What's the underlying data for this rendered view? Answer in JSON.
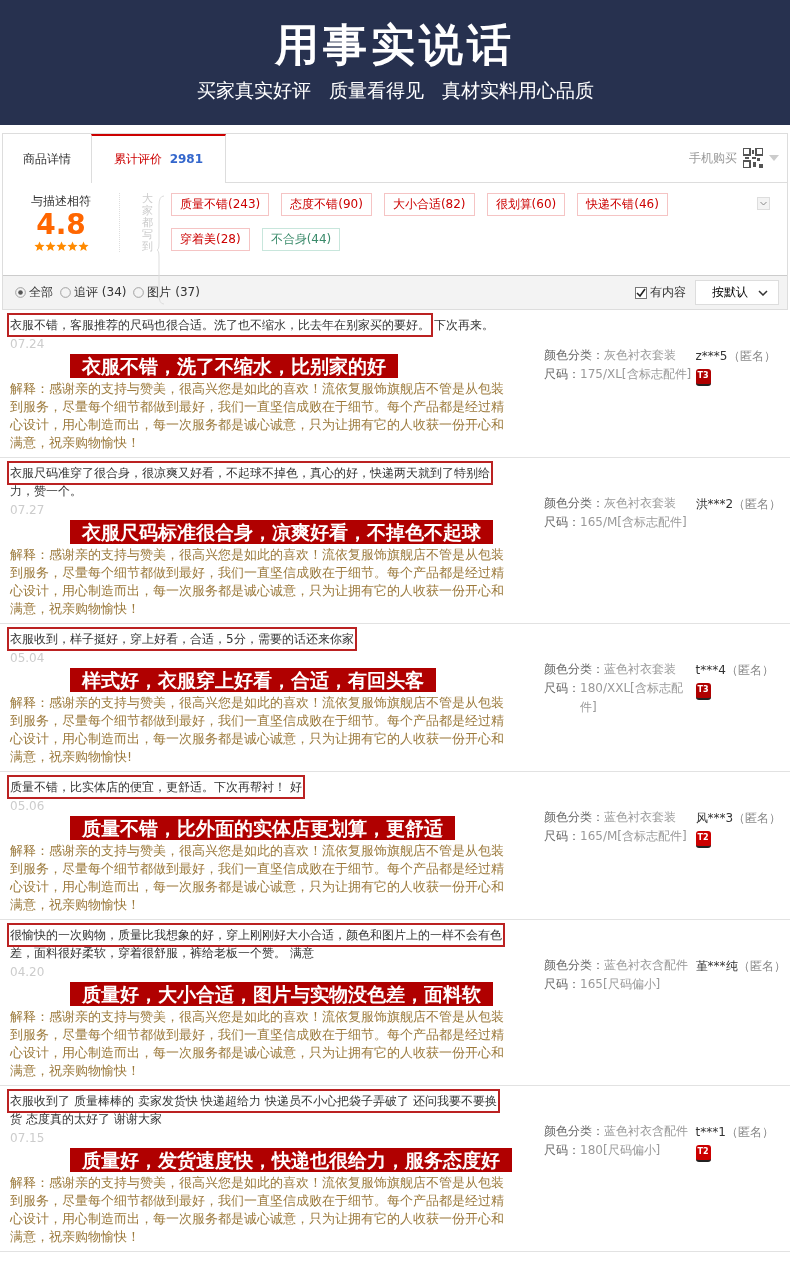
{
  "header": {
    "title": "用事实说话",
    "subtitle": [
      "买家真实好评",
      "质量看得见",
      "真材实料用心品质"
    ]
  },
  "tabs": [
    {
      "label": "商品详情",
      "selected": false
    },
    {
      "label": "累计评价",
      "count": "2981",
      "selected": true
    }
  ],
  "mobile_buy": {
    "label": "手机购买"
  },
  "rating": {
    "label": "与描述相符",
    "score": "4.8",
    "stars": 5
  },
  "tags_heading": "大家都写到",
  "tags": [
    {
      "label": "质量不错(243)",
      "kind": "positive"
    },
    {
      "label": "态度不错(90)",
      "kind": "positive"
    },
    {
      "label": "大小合适(82)",
      "kind": "positive"
    },
    {
      "label": "很划算(60)",
      "kind": "positive"
    },
    {
      "label": "快递不错(46)",
      "kind": "positive"
    },
    {
      "label": "穿着美(28)",
      "kind": "positive"
    },
    {
      "label": "不合身(44)",
      "kind": "negative"
    }
  ],
  "filters": [
    {
      "label": "全部",
      "selected": true
    },
    {
      "label": "追评 (34)",
      "selected": false
    },
    {
      "label": "图片 (37)",
      "selected": false
    }
  ],
  "content_filter": {
    "label": "有内容",
    "checked": true
  },
  "sort": {
    "label": "按默认"
  },
  "reviews": [
    {
      "comment_boxed": "衣服不错，客服推荐的尺码也很合适。洗了也不缩水，比去年在别家买的要好。",
      "comment_rest": "下次再来。",
      "date": "07.24",
      "highlight": "衣服不错，洗了不缩水，比别家的好",
      "reply": "解释：感谢亲的支持与赞美，很高兴您是如此的喜欢！流依复服饰旗舰店不管是从包装到服务，尽量每个细节都做到最好，我们一直坚信成败在于细节。每个产品都是经过精心设计，用心制造而出，每一次服务都是诚心诚意，只为让拥有它的人收获一份开心和满意，祝亲购物愉快！",
      "color_label": "颜色分类：",
      "color_value": "灰色衬衣套装",
      "size_label": "尺码：",
      "size": "175/XL[含标志配件]",
      "user": "z***5",
      "anonymous": "（匿名）",
      "badge": "T3"
    },
    {
      "comment_boxed": "衣服尺码准穿了很合身，很凉爽又好看，不起球不掉色，真心的好，快递两天就到了特别给",
      "comment_rest": "力，赞一个。",
      "date": "07.27",
      "highlight": "衣服尺码标准很合身，凉爽好看，不掉色不起球",
      "reply": "解释：感谢亲的支持与赞美，很高兴您是如此的喜欢！流依复服饰旗舰店不管是从包装到服务，尽量每个细节都做到最好，我们一直坚信成败在于细节。每个产品都是经过精心设计，用心制造而出，每一次服务都是诚心诚意，只为让拥有它的人收获一份开心和满意，祝亲购物愉快！",
      "color_label": "颜色分类：",
      "color_value": "灰色衬衣套装",
      "size_label": "尺码：",
      "size": "165/M[含标志配件]",
      "user": "洪***2",
      "anonymous": "（匿名）"
    },
    {
      "comment_boxed": "衣服收到，样子挺好，穿上好看，合适，5分，需要的话还来你家",
      "date": "05.04",
      "highlight": "样式好，衣服穿上好看，合适，有回头客",
      "reply": "解释：感谢亲的支持与赞美，很高兴您是如此的喜欢！流依复服饰旗舰店不管是从包装到服务，尽量每个细节都做到最好，我们一直坚信成败在于细节。每个产品都是经过精心设计，用心制造而出，每一次服务都是诚心诚意，只为让拥有它的人收获一份开心和满意，祝亲购物愉快!",
      "color_label": "颜色分类：",
      "color_value": "蓝色衬衣套装",
      "size_label": "尺码：",
      "size": "180/XXL[含标志配件]",
      "user": "t***4",
      "anonymous": "（匿名）",
      "badge": "T3"
    },
    {
      "comment_boxed": "质量不错，比实体店的便宜，更舒适。下次再帮衬！ 好",
      "date": "05.06",
      "highlight": "质量不错，比外面的实体店更划算，更舒适",
      "reply": "解释：感谢亲的支持与赞美，很高兴您是如此的喜欢！流依复服饰旗舰店不管是从包装到服务，尽量每个细节都做到最好，我们一直坚信成败在于细节。每个产品都是经过精心设计，用心制造而出，每一次服务都是诚心诚意，只为让拥有它的人收获一份开心和满意，祝亲购物愉快！",
      "color_label": "颜色分类：",
      "color_value": "蓝色衬衣套装",
      "size_label": "尺码：",
      "size": "165/M[含标志配件]",
      "user": "风***3",
      "anonymous": "（匿名）",
      "badge": "T2"
    },
    {
      "comment_boxed": "很愉快的一次购物，质量比我想象的好，穿上刚刚好大小合适，颜色和图片上的一样不会有色",
      "comment_rest": "差，面料很好柔软，穿着很舒服，裤给老板一个赞。 满意",
      "date": "04.20",
      "highlight": "质量好，大小合适，图片与实物没色差，面料软",
      "reply": "解释：感谢亲的支持与赞美，很高兴您是如此的喜欢！流依复服饰旗舰店不管是从包装到服务，尽量每个细节都做到最好，我们一直坚信成败在于细节。每个产品都是经过精心设计，用心制造而出，每一次服务都是诚心诚意，只为让拥有它的人收获一份开心和满意，祝亲购物愉快！",
      "color_label": "颜色分类：",
      "color_value": "蓝色衬衣含配件",
      "size_label": "尺码：",
      "size": "165[尺码偏小]",
      "user": "堇***纯",
      "anonymous": "（匿名）"
    },
    {
      "comment_boxed": "衣服收到了 质量棒棒的 卖家发货快 快递超给力 快递员不小心把袋子弄破了 还问我要不要换",
      "comment_rest": "货 态度真的太好了 谢谢大家",
      "date": "07.15",
      "highlight": "质量好，发货速度快，快递也很给力，服务态度好",
      "reply": "解释：感谢亲的支持与赞美，很高兴您是如此的喜欢！流依复服饰旗舰店不管是从包装到服务，尽量每个细节都做到最好，我们一直坚信成败在于细节。每个产品都是经过精心设计，用心制造而出，每一次服务都是诚心诚意，只为让拥有它的人收获一份开心和满意，祝亲购物愉快！",
      "color_label": "颜色分类：",
      "color_value": "蓝色衬衣含配件",
      "size_label": "尺码：",
      "size": "180[尺码偏小]",
      "user": "t***1",
      "anonymous": "（匿名）",
      "badge": "T2"
    }
  ]
}
